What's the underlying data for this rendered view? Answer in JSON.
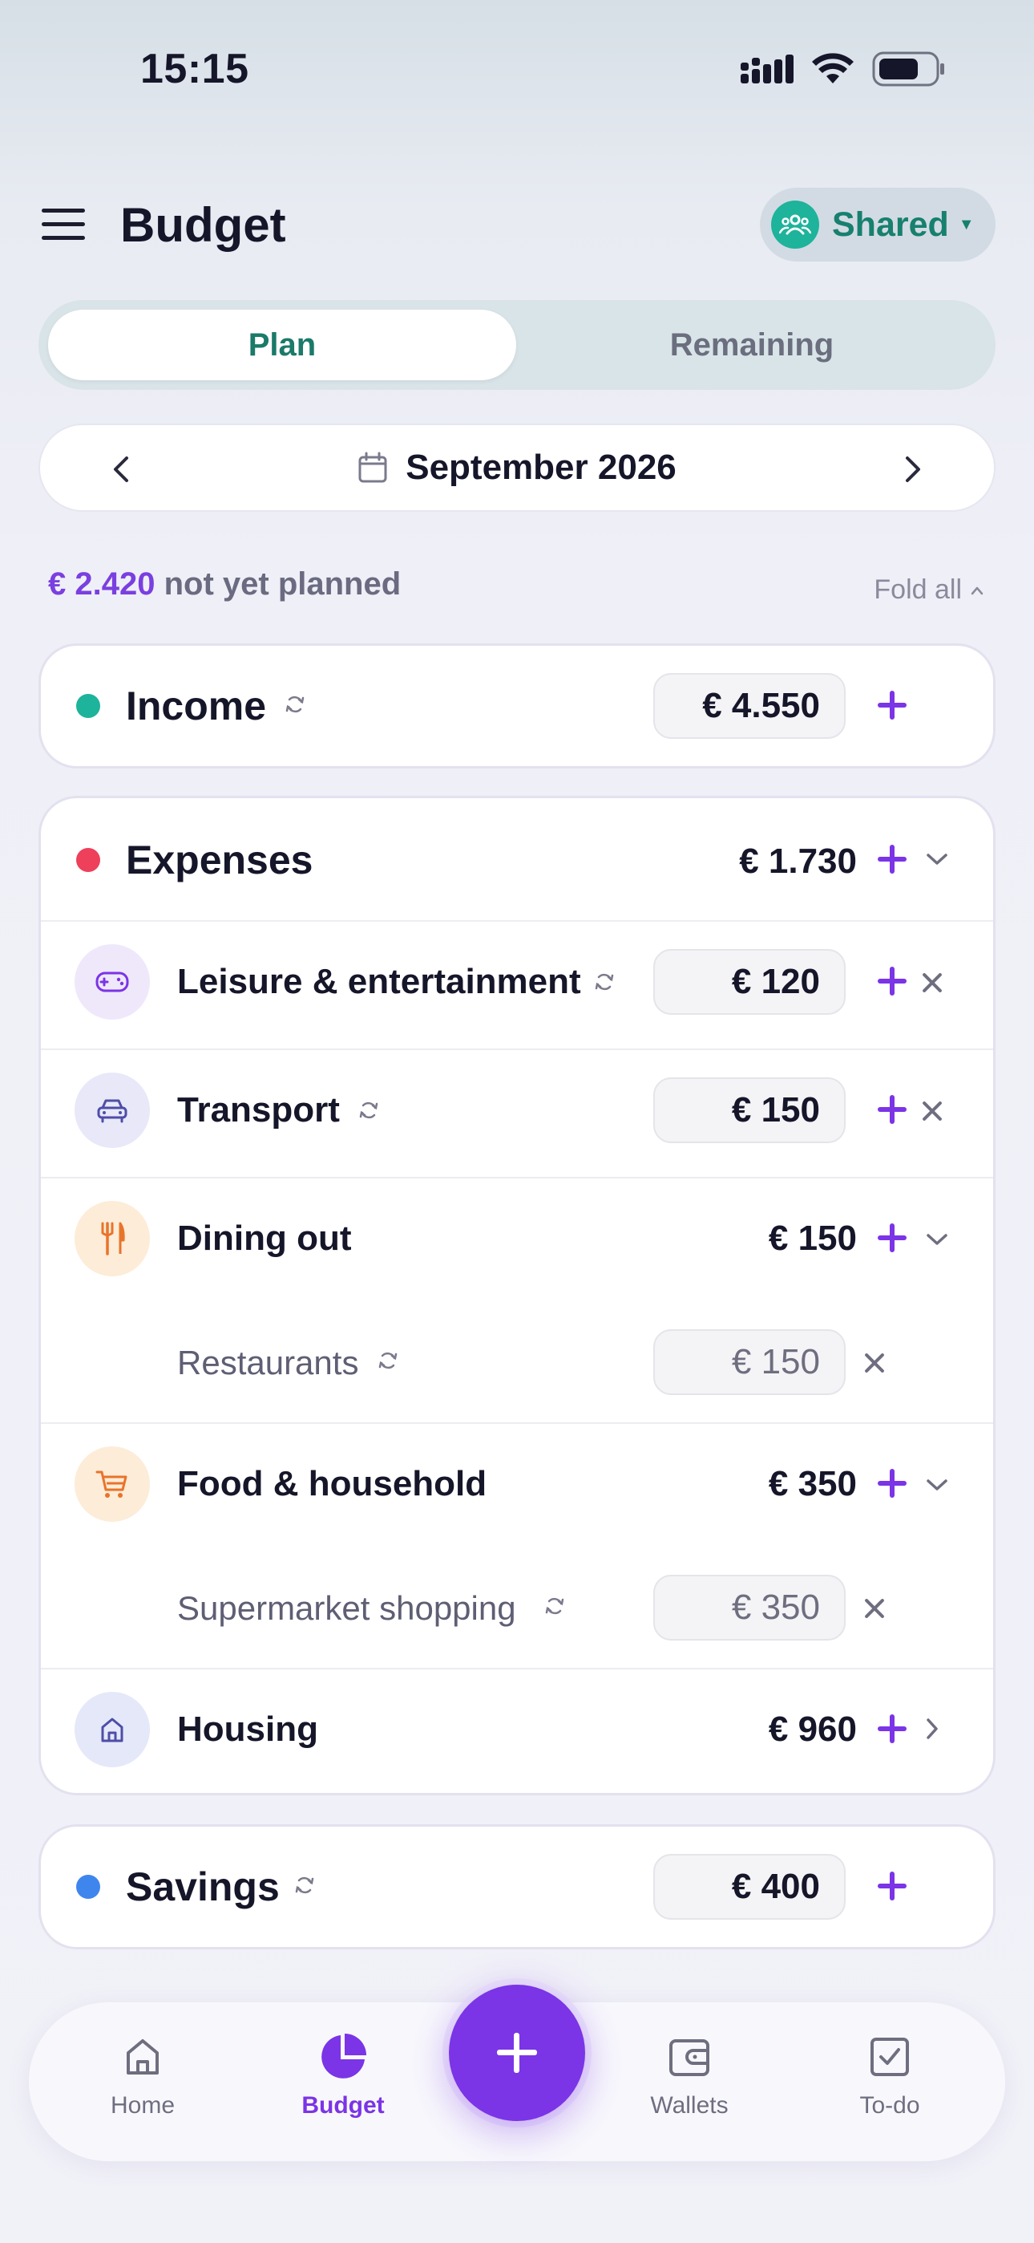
{
  "status_bar": {
    "time": "15:15"
  },
  "header": {
    "title": "Budget",
    "shared_label": "Shared"
  },
  "tabs": [
    {
      "label": "Plan",
      "active": true
    },
    {
      "label": "Remaining",
      "active": false
    }
  ],
  "month_nav": {
    "label": "September 2026"
  },
  "summary": {
    "amount": "€ 2.420",
    "text": "not yet planned",
    "fold_all": "Fold all"
  },
  "income": {
    "label": "Income",
    "amount": "€ 4.550",
    "color": "#1eb39b"
  },
  "expenses": {
    "label": "Expenses",
    "amount": "€ 1.730",
    "color": "#ee3f5b",
    "categories": [
      {
        "label": "Leisure & entertainment",
        "amount": "€ 120",
        "icon": "gamepad-icon"
      },
      {
        "label": "Transport",
        "amount": "€ 150",
        "icon": "car-icon"
      },
      {
        "label": "Dining out",
        "amount": "€ 150",
        "icon": "cutlery-icon",
        "sub": {
          "label": "Restaurants",
          "amount": "€ 150"
        }
      },
      {
        "label": "Food & household",
        "amount": "€ 350",
        "icon": "cart-icon",
        "sub": {
          "label": "Supermarket shopping",
          "amount": "€ 350"
        }
      },
      {
        "label": "Housing",
        "amount": "€ 960",
        "icon": "house-icon"
      }
    ]
  },
  "savings": {
    "label": "Savings",
    "amount": "€ 400",
    "color": "#3f85ee"
  },
  "bottom_nav": {
    "items": [
      {
        "label": "Home",
        "icon": "home-icon",
        "active": false
      },
      {
        "label": "Budget",
        "icon": "pie-chart-icon",
        "active": true
      },
      {
        "label": "Wallets",
        "icon": "wallet-icon",
        "active": false
      },
      {
        "label": "To-do",
        "icon": "checkbox-icon",
        "active": false
      }
    ]
  },
  "colors": {
    "accent": "#7b34e6",
    "teal": "#17806f"
  }
}
